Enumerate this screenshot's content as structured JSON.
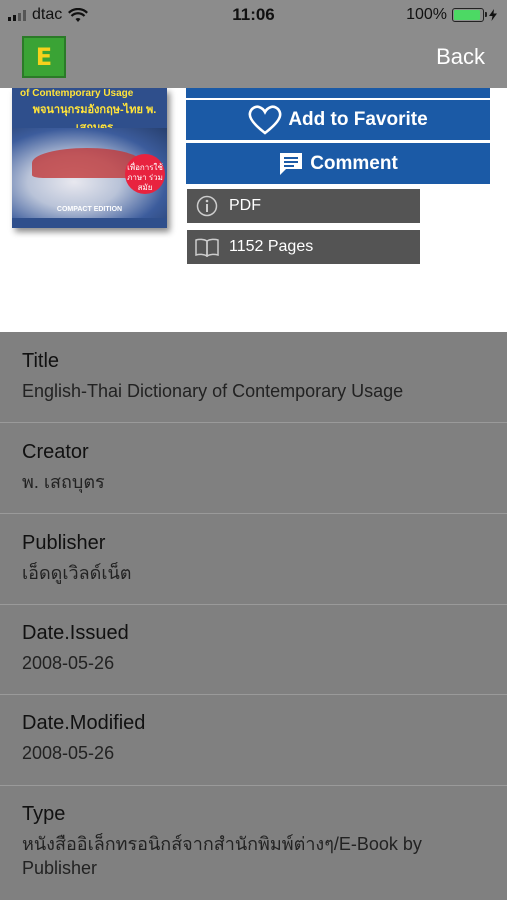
{
  "status_bar": {
    "carrier": "dtac",
    "time": "11:06",
    "battery": "100%"
  },
  "nav": {
    "logo_letter": "E",
    "back_label": "Back"
  },
  "cover": {
    "title_en": "of Contemporary Usage",
    "title_th": "พจนานุกรมอังกฤษ-ไทย พ. เสถบุตร",
    "badge": "เพื่อการใช้ ภาษา ร่วมสมัย",
    "edition": "COMPACT EDITION"
  },
  "actions": {
    "favorite_label": "Add to Favorite",
    "comment_label": "Comment"
  },
  "info": {
    "format": "PDF",
    "pages": "1152 Pages"
  },
  "metadata": [
    {
      "key": "Title",
      "value": "English-Thai Dictionary of Contemporary Usage"
    },
    {
      "key": "Creator",
      "value": "พ. เสถบุตร"
    },
    {
      "key": "Publisher",
      "value": "เอ็ดดูเวิลด์เน็ต"
    },
    {
      "key": "Date.Issued",
      "value": "2008-05-26"
    },
    {
      "key": "Date.Modified",
      "value": "2008-05-26"
    },
    {
      "key": "Type",
      "value": "หนังสืออิเล็กทรอนิกส์จากสำนักพิมพ์ต่างๆ/E-Book by Publisher"
    }
  ],
  "colors": {
    "button_blue": "#1b5aa6",
    "info_gray": "#545454",
    "list_gray": "#808080",
    "battery_green": "#4cd964"
  },
  "icons": [
    "wifi-icon",
    "heart-icon",
    "comment-icon",
    "info-icon",
    "book-icon",
    "charging-icon"
  ]
}
